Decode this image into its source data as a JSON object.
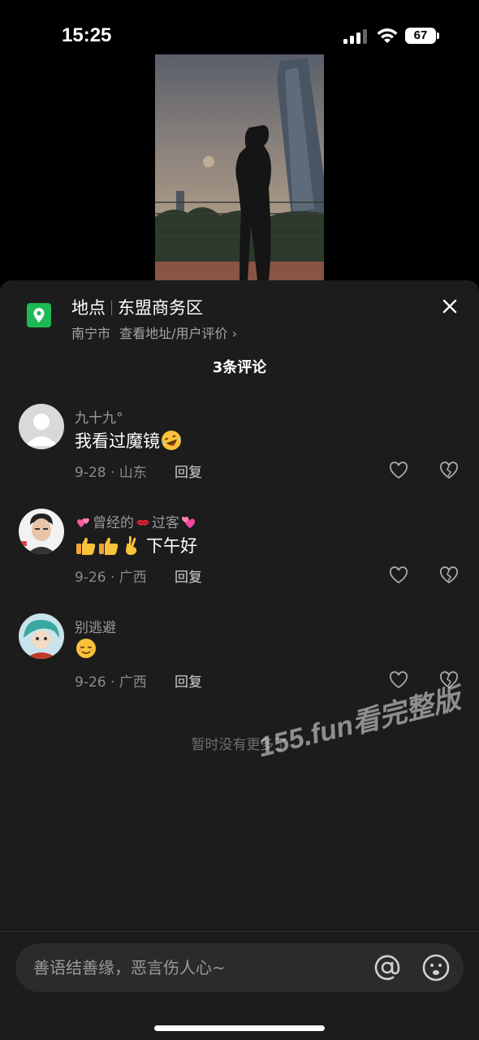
{
  "status": {
    "time": "15:25",
    "battery": "67"
  },
  "location": {
    "label": "地点",
    "name": "东盟商务区",
    "city": "南宁市",
    "link": "查看地址/用户评价",
    "chevron": "›"
  },
  "comments_header": "3条评论",
  "comments": [
    {
      "name": "九十九°",
      "text": "我看过魔镜",
      "emoji": "rofl-emoji",
      "meta": "9-28 · 山东",
      "reply": "回复"
    },
    {
      "name_a": "曾经的",
      "name_b": "过客",
      "text": "下午好",
      "emoji": [
        "thumbs-up-emoji",
        "thumbs-up-emoji",
        "crossed-fingers-emoji"
      ],
      "meta": "9-26 · 广西",
      "reply": "回复"
    },
    {
      "name": "别逃避",
      "emoji": "relieved-face-emoji",
      "meta": "9-26 · 广西",
      "reply": "回复"
    }
  ],
  "no_more": "暂时没有更多了",
  "watermark": "155.fun看完整版",
  "input": {
    "placeholder": "善语结善缘，恶言伤人心~"
  },
  "colors": {
    "sheet_bg": "#1c1c1c",
    "location_icon": "#1db954",
    "input_bg": "#2b2b2b"
  }
}
